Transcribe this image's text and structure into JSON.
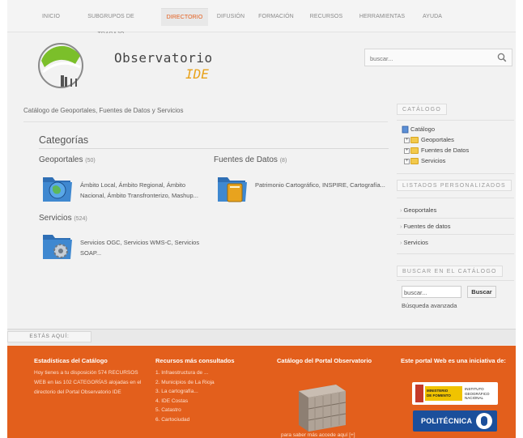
{
  "nav": {
    "items": [
      {
        "label": "INICIO",
        "active": false
      },
      {
        "label": "SUBGRUPOS DE TRABAJO",
        "active": false
      },
      {
        "label": "DIRECTORIO",
        "active": true
      },
      {
        "label": "DIFUSIÓN",
        "active": false
      },
      {
        "label": "FORMACIÓN",
        "active": false
      },
      {
        "label": "RECURSOS",
        "active": false
      },
      {
        "label": "HERRAMIENTAS",
        "active": false
      },
      {
        "label": "AYUDA",
        "active": false
      }
    ]
  },
  "header": {
    "logo_title": "Observatorio",
    "logo_sub": "IDE",
    "search_placeholder": "buscar..."
  },
  "main": {
    "breadcrumb": "Catálogo de Geoportales, Fuentes de Datos y Servicios",
    "categories_title": "Categorías",
    "groups": [
      {
        "title": "Geoportales",
        "count": "(50)",
        "desc_line1": "Ámbito Local, Ámbito Regional, Ámbito",
        "desc_line2": "Nacional, Ámbito Transfronterizo, Mashup..."
      },
      {
        "title": "Fuentes de Datos",
        "count": "(8)",
        "desc_line1": "Patrimonio Cartográfico, INSPIRE, Cartografía..."
      },
      {
        "title": "Servicios",
        "count": "(524)",
        "desc_line1": "Servicios OGC, Servicios WMS-C, Servicios",
        "desc_line2": "SOAP..."
      }
    ]
  },
  "sidebar": {
    "catalog_head": "CATÁLOGO",
    "tree_root": "Catálogo",
    "tree_items": [
      "Geoportales",
      "Fuentes de Datos",
      "Servicios"
    ],
    "lists_head": "LISTADOS PERSONALIZADOS",
    "lists": [
      "Geoportales",
      "Fuentes de datos",
      "Servicios"
    ],
    "search_head": "BUSCAR EN EL CATÁLOGO",
    "search_value": "buscar...",
    "search_button": "Buscar",
    "advanced": "Búsqueda avanzada"
  },
  "here_bar": {
    "label": "ESTÁS AQUÍ:"
  },
  "footer": {
    "stats_title": "Estadísticas del Catálogo",
    "stats_lines": [
      "Hoy tienes a tu disposición 574 RECURSOS",
      "WEB en las 102 CATEGORÍAS alojadas en el",
      "directorio del Portal Observatorio IDE"
    ],
    "top_title": "Recursos más consultados",
    "top_items": [
      "1. Infraestructura de ...",
      "2. Municipios de La Rioja",
      "3. La cartografía...",
      "4. IDE Costas",
      "5. Catastro",
      "6. Cartociudad"
    ],
    "portal_title": "Catálogo del Portal Observatorio",
    "portal_bottom": "para saber más accede aquí [+]",
    "initiative_title": "Este portal Web es una iniciativa de:",
    "ministry_lines": [
      "MINISTERIO",
      "DE FOMENTO"
    ],
    "ign_lines": [
      "INSTITUTO",
      "GEOGRÁFICO",
      "NACIONAL"
    ],
    "upm_label": "POLITÉCNICA"
  },
  "colors": {
    "accent": "#e45c1a",
    "footer_bg": "#e35f1c",
    "page_bg": "#f2f2f2"
  }
}
